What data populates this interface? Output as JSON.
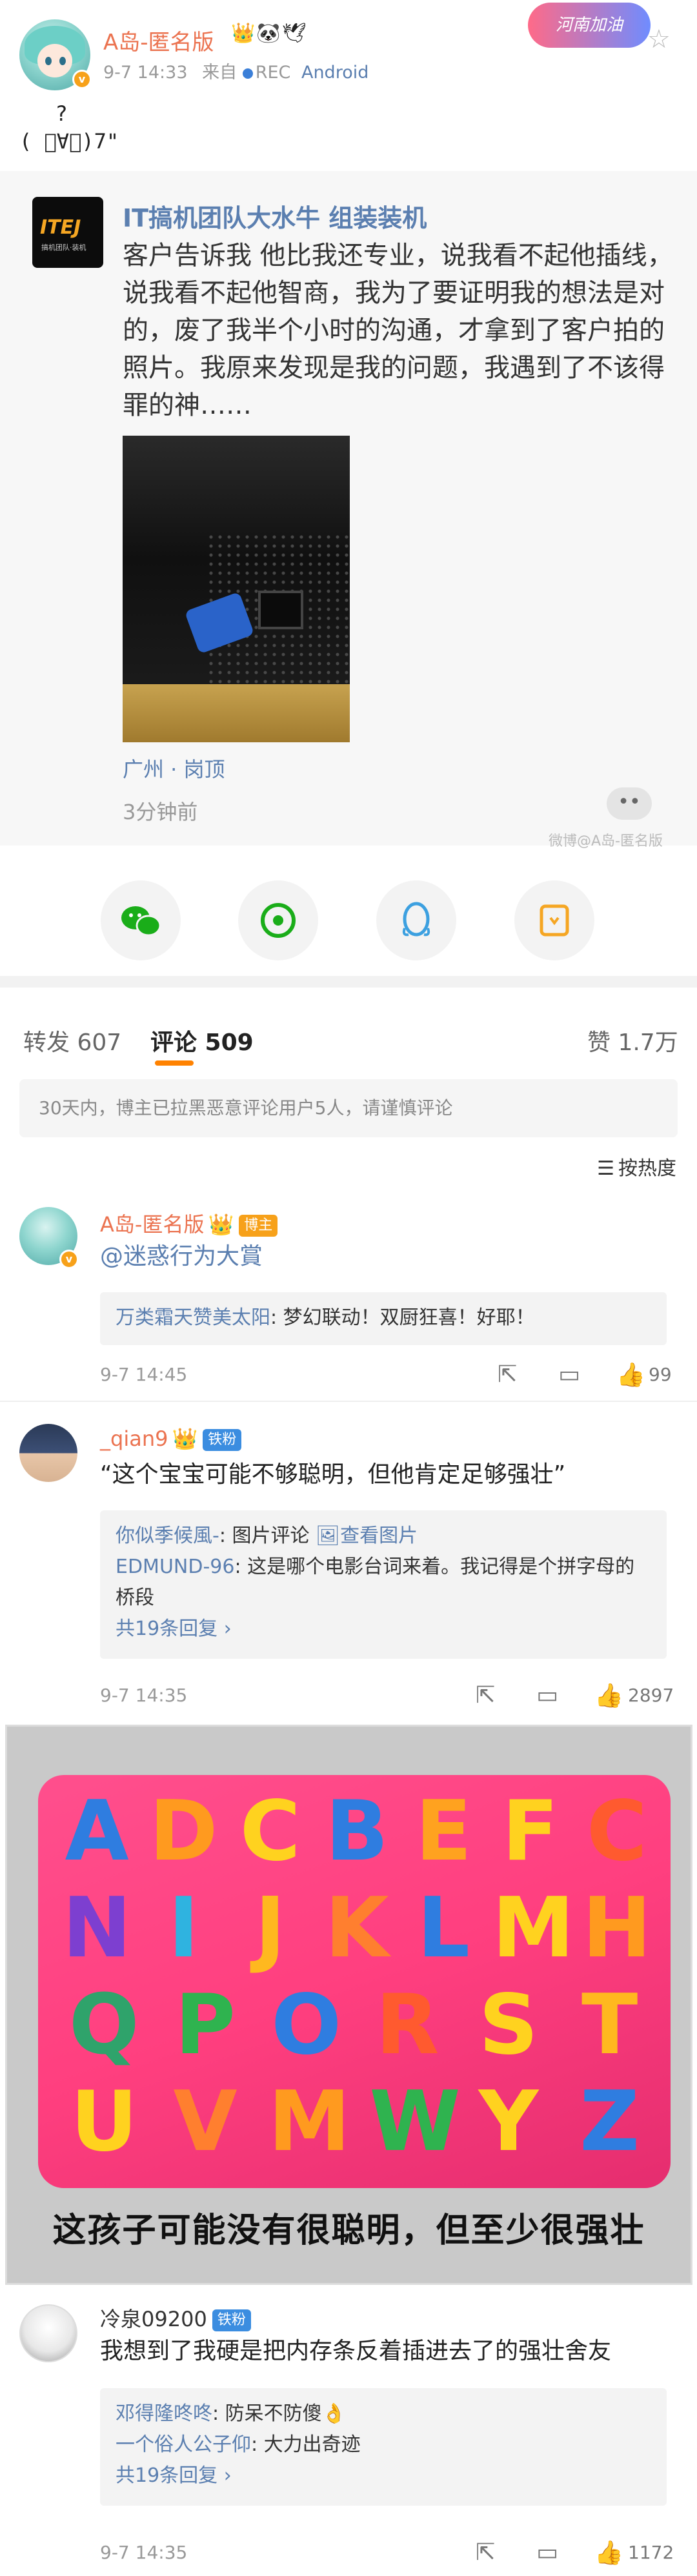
{
  "post": {
    "author": "A岛-匿名版",
    "author_emojis": "👑🐼🕊",
    "verified_badge": "v",
    "time": "9-7 14:33",
    "source_prefix": "来自",
    "source": "REC",
    "device": "Android",
    "decor_text": "河南加油",
    "kaomoji_line1": "?",
    "kaomoji_line2": "( ﾟ∀。)7\""
  },
  "repost": {
    "author": "IT搞机团队大水牛 组装装机",
    "logo_text": "ITEJ",
    "logo_subtext": "搞机团队·装机",
    "text": "客户告诉我 他比我还专业，说我看不起他插线，说我看不起他智商，我为了要证明我的想法是对的，废了我半个小时的沟通，才拿到了客户拍的照片。我原来发现是我的问题，我遇到了不该得罪的神……",
    "location": "广州 · 岗顶",
    "time": "3分钟前",
    "more": "••",
    "watermark": "微博@A岛-匿名版"
  },
  "share": {
    "wechat_icon": "wechat-icon",
    "moments_icon": "moments-icon",
    "qq_icon": "qq-icon",
    "save_icon": "save-image-icon"
  },
  "tabs": {
    "repost": "转发 607",
    "comments": "评论 509",
    "likes": "赞 1.7万"
  },
  "notice": "30天内，博主已拉黑恶意评论用户5人，请谨慎评论",
  "sort": {
    "label": "按热度"
  },
  "comments": [
    {
      "name": "A岛-匿名版",
      "badge": "博主",
      "mention": "@迷惑行为大賞",
      "text": "",
      "replies": [
        {
          "name": "万类霜天赞美太阳",
          "text": ": 梦幻联动！双厨狂喜！好耶！"
        }
      ],
      "time": "9-7 14:45",
      "likes": "99"
    },
    {
      "name": "_qian9",
      "badge": "铁粉",
      "text": "“这个宝宝可能不够聪明，但他肯定足够强壮”",
      "replies": [
        {
          "name": "你似季候風-",
          "text": ": 图片评论 ",
          "link": "查看图片"
        },
        {
          "name": "EDMUND-96",
          "text": ": 这是哪个电影台词来着。我记得是个拼字母的桥段"
        }
      ],
      "more": "共19条回复 ›",
      "time": "9-7 14:35",
      "likes": "2897"
    },
    {
      "name": "冷泉09200",
      "badge": "铁粉",
      "text": "我想到了我硬是把内存条反着插进去了的强壮舍友",
      "replies": [
        {
          "name": "邓得隆咚咚",
          "text": ": 防呆不防傻👌"
        },
        {
          "name": "一个俗人公子仰",
          "text": ": 大力出奇迹"
        }
      ],
      "more": "共19条回复 ›",
      "time": "9-7 14:35",
      "likes": "1172"
    }
  ],
  "meme": {
    "letters": [
      "A",
      "D",
      "C",
      "B",
      "E",
      "F",
      "C",
      "N",
      "I",
      "J",
      "K",
      "L",
      "M",
      "H",
      "Q",
      "P",
      "O",
      "R",
      "S",
      "T",
      "U",
      "V",
      "M",
      "W",
      "Y",
      "Z"
    ],
    "caption": "这孩子可能没有很聪明，但至少很强壮"
  },
  "icons": {
    "star": "star-icon",
    "share": "share-icon",
    "comment": "comment-icon",
    "like": "thumbs-up-icon"
  }
}
